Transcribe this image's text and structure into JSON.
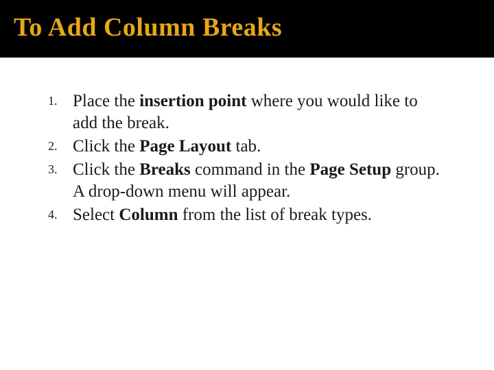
{
  "title": "To Add Column Breaks",
  "steps": [
    {
      "pre": "Place the ",
      "bold1": "insertion point",
      "mid1": " where you would like to add the break.",
      "bold2": "",
      "mid2": "",
      "bold3": "",
      "post": ""
    },
    {
      "pre": "Click the ",
      "bold1": "Page Layout",
      "mid1": " tab.",
      "bold2": "",
      "mid2": "",
      "bold3": "",
      "post": ""
    },
    {
      "pre": "Click the ",
      "bold1": "Breaks",
      "mid1": " command in the ",
      "bold2": "Page Setup",
      "mid2": " group. A drop-down menu will appear.",
      "bold3": "",
      "post": ""
    },
    {
      "pre": "Select ",
      "bold1": "Column",
      "mid1": " from the list of break types.",
      "bold2": "",
      "mid2": "",
      "bold3": "",
      "post": ""
    }
  ]
}
